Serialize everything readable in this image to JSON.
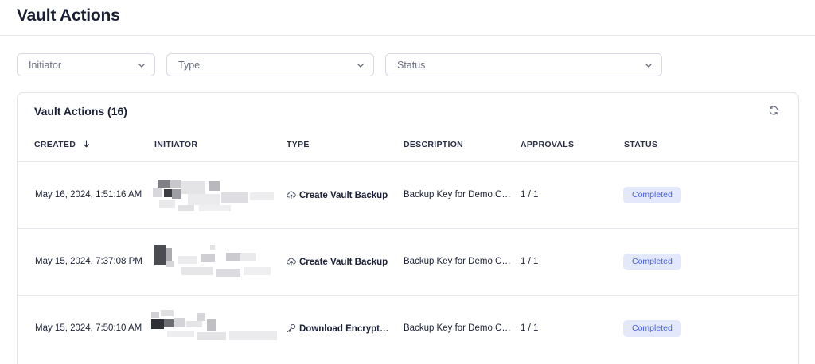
{
  "page": {
    "title": "Vault Actions"
  },
  "filters": [
    {
      "placeholder": "Initiator"
    },
    {
      "placeholder": "Type"
    },
    {
      "placeholder": "Status"
    }
  ],
  "card": {
    "title": "Vault Actions (16)"
  },
  "columns": {
    "created": "CREATED",
    "initiator": "INITIATOR",
    "type": "TYPE",
    "description": "DESCRIPTION",
    "approvals": "APPROVALS",
    "status": "STATUS"
  },
  "rows": [
    {
      "created": "May 16, 2024, 1:51:16 AM",
      "type": "Create Vault Backup",
      "type_icon": "cloud-upload-icon",
      "description": "Backup Key for Demo Ca...",
      "approvals": "1 / 1",
      "status": "Completed"
    },
    {
      "created": "May 15, 2024, 7:37:08 PM",
      "type": "Create Vault Backup",
      "type_icon": "cloud-upload-icon",
      "description": "Backup Key for Demo Ca...",
      "approvals": "1 / 1",
      "status": "Completed"
    },
    {
      "created": "May 15, 2024, 7:50:10 AM",
      "type": "Download Encrypted ...",
      "type_icon": "key-icon",
      "description": "Backup Key for Demo Ca...",
      "approvals": "1 / 1",
      "status": "Completed"
    }
  ],
  "colors": {
    "badge_bg": "#e3e8fb",
    "badge_text": "#4a63d8",
    "text_primary": "#1a1f36",
    "border": "#e6e8ee"
  },
  "icons": {
    "sort": "arrow-down-icon",
    "refresh": "refresh-icon",
    "dropdown": "chevron-down-icon"
  }
}
